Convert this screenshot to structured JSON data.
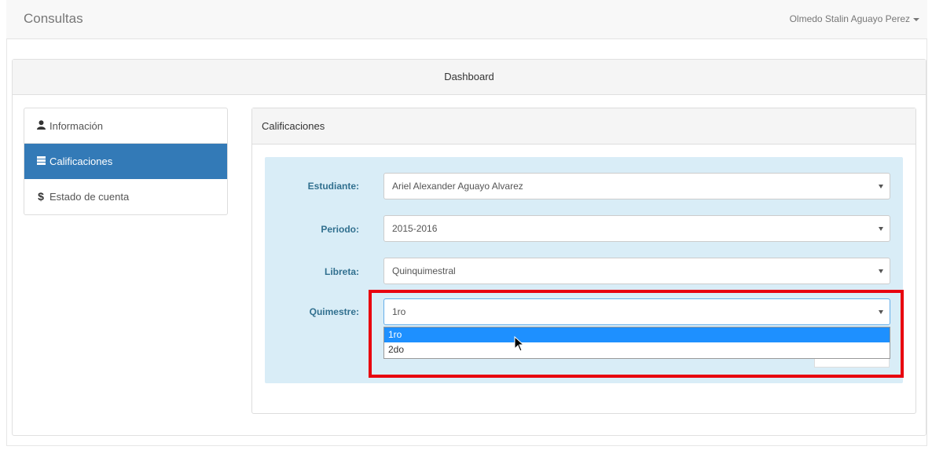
{
  "navbar": {
    "brand": "Consultas",
    "user": "Olmedo Stalin Aguayo Perez"
  },
  "dashboard": {
    "title": "Dashboard"
  },
  "sidebar": {
    "items": [
      {
        "label": "Información",
        "icon": "user-icon",
        "active": false
      },
      {
        "label": "Calificaciones",
        "icon": "list-icon",
        "active": true
      },
      {
        "label": "Estado de cuenta",
        "icon": "dollar-icon",
        "active": false
      }
    ]
  },
  "calificaciones": {
    "title": "Calificaciones",
    "fields": {
      "estudiante": {
        "label": "Estudiante:",
        "value": "Ariel Alexander Aguayo Alvarez"
      },
      "periodo": {
        "label": "Periodo:",
        "value": "2015-2016"
      },
      "libreta": {
        "label": "Libreta:",
        "value": "Quinquimestral"
      },
      "quimestre": {
        "label": "Quimestre:",
        "value": "1ro",
        "options": [
          "1ro",
          "2do"
        ]
      }
    }
  },
  "colors": {
    "accent": "#337ab7",
    "well": "#d9edf7",
    "highlight": "#e8000e",
    "option_selected": "#1e90ff"
  }
}
